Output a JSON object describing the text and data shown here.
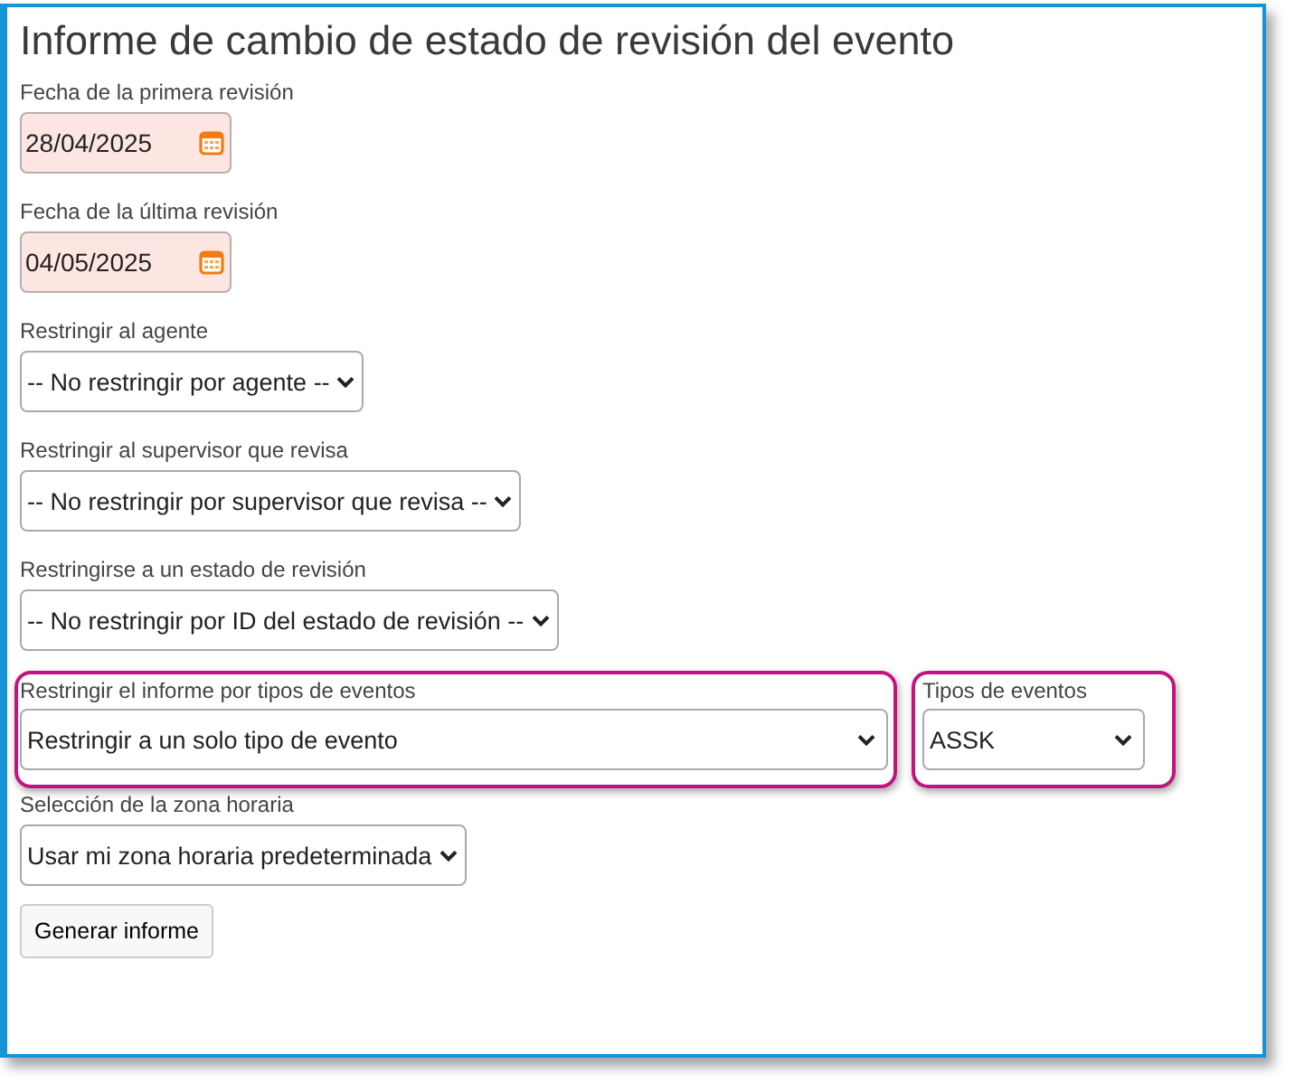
{
  "title": "Informe de cambio de estado de revisión del evento",
  "rows": [
    [
      {
        "kind": "date",
        "label": "Fecha de la primera revisión",
        "value": "28/04/2025",
        "highlighted": false
      }
    ],
    [
      {
        "kind": "date",
        "label": "Fecha de la última revisión",
        "value": "04/05/2025",
        "highlighted": false
      }
    ],
    [
      {
        "kind": "select",
        "label": "Restringir al agente",
        "value": "-- No restringir por agente --",
        "highlighted": false
      }
    ],
    [
      {
        "kind": "select",
        "label": "Restringir al supervisor que revisa",
        "value": "-- No restringir por supervisor que revisa --",
        "highlighted": false
      }
    ],
    [
      {
        "kind": "select",
        "label": "Restringirse a un estado de revisión",
        "value": "-- No restringir por ID del estado de revisión --",
        "highlighted": false
      }
    ],
    [
      {
        "kind": "select",
        "label": "Restringir el informe por tipos de eventos",
        "value": "Restringir a un solo tipo de evento",
        "highlighted": true
      },
      {
        "kind": "select",
        "label": "Tipos de eventos",
        "value": "ASSK",
        "highlighted": true
      }
    ],
    [
      {
        "kind": "select",
        "label": "Selección de la zona horaria",
        "value": "Usar mi zona horaria predeterminada",
        "highlighted": false
      }
    ]
  ],
  "button": "Generar informe"
}
